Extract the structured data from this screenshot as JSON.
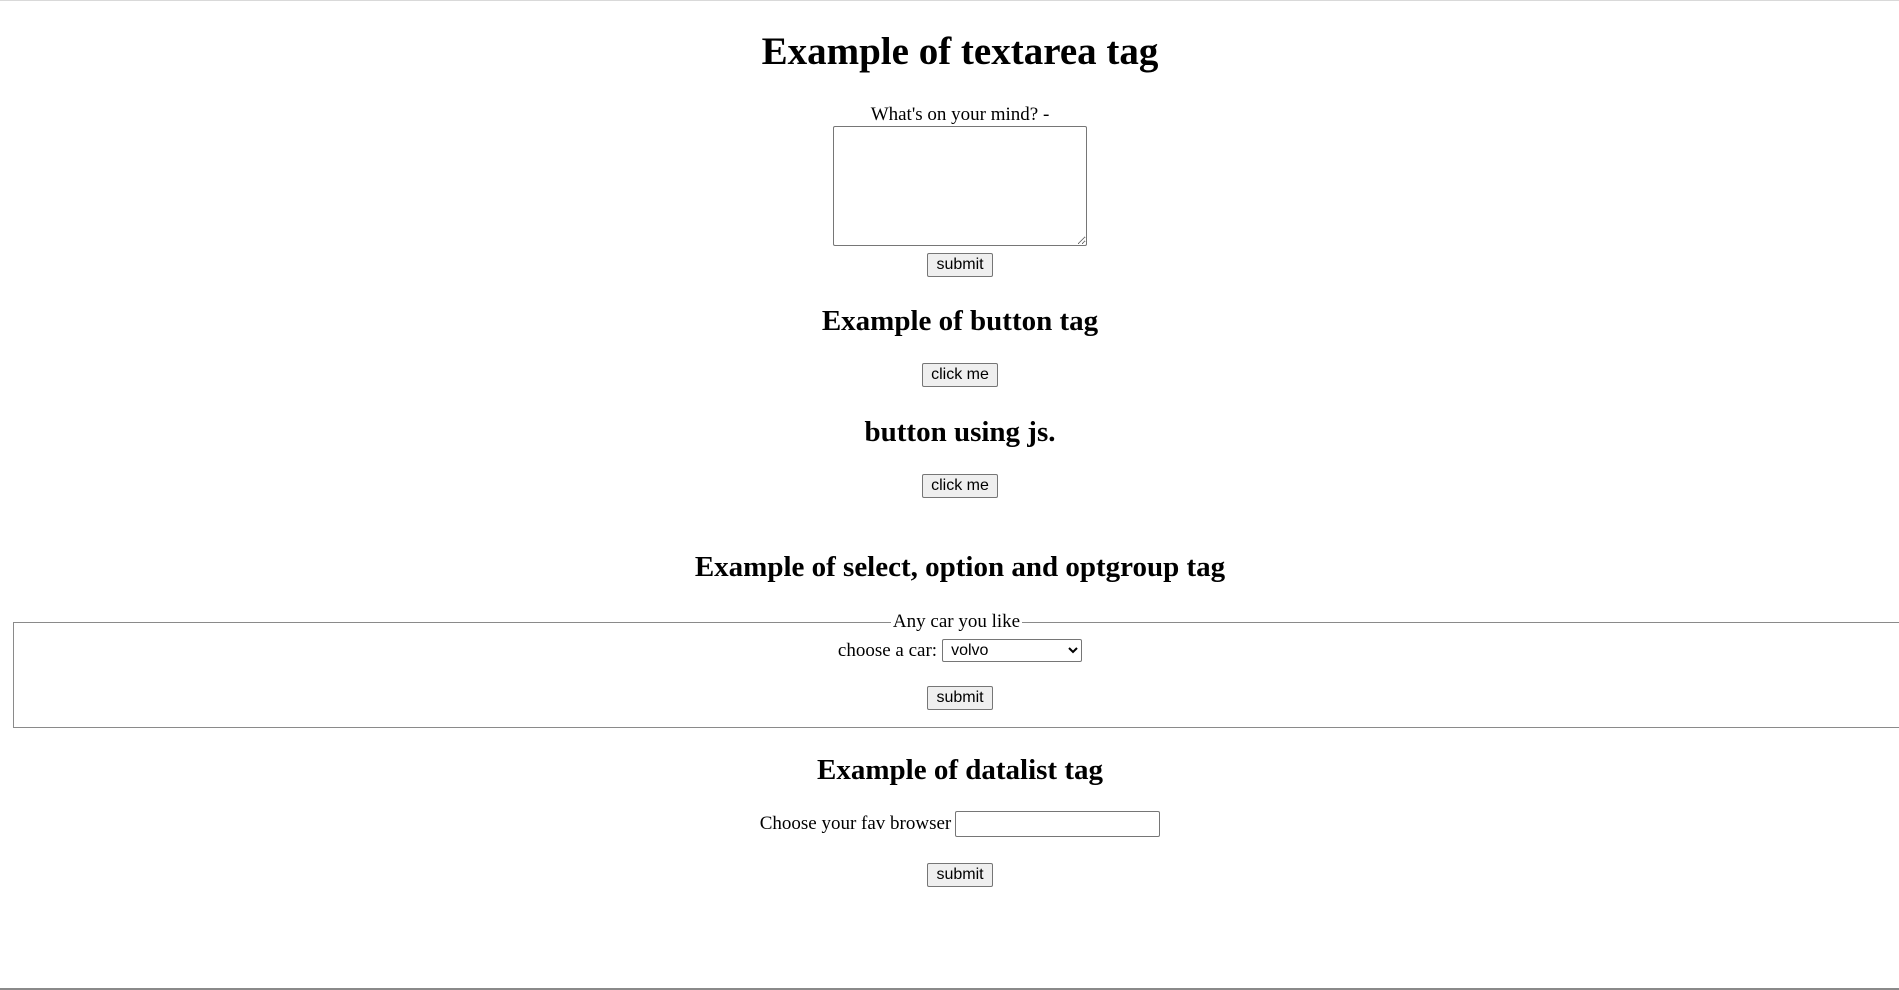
{
  "textarea_section": {
    "title": "Example of textarea tag",
    "label": "What's on your mind? -",
    "textarea_value": "",
    "submit_label": "submit"
  },
  "button_section": {
    "title": "Example of button tag",
    "button_label": "click me"
  },
  "js_button_section": {
    "title": "button using js.",
    "button_label": "click me"
  },
  "select_section": {
    "title": "Example of select, option and optgroup tag",
    "legend": "Any car you like",
    "label": "choose a car:",
    "selected": "volvo",
    "submit_label": "submit"
  },
  "datalist_section": {
    "title": "Example of datalist tag",
    "label": "Choose your fav browser",
    "input_value": "",
    "submit_label": "submit"
  }
}
